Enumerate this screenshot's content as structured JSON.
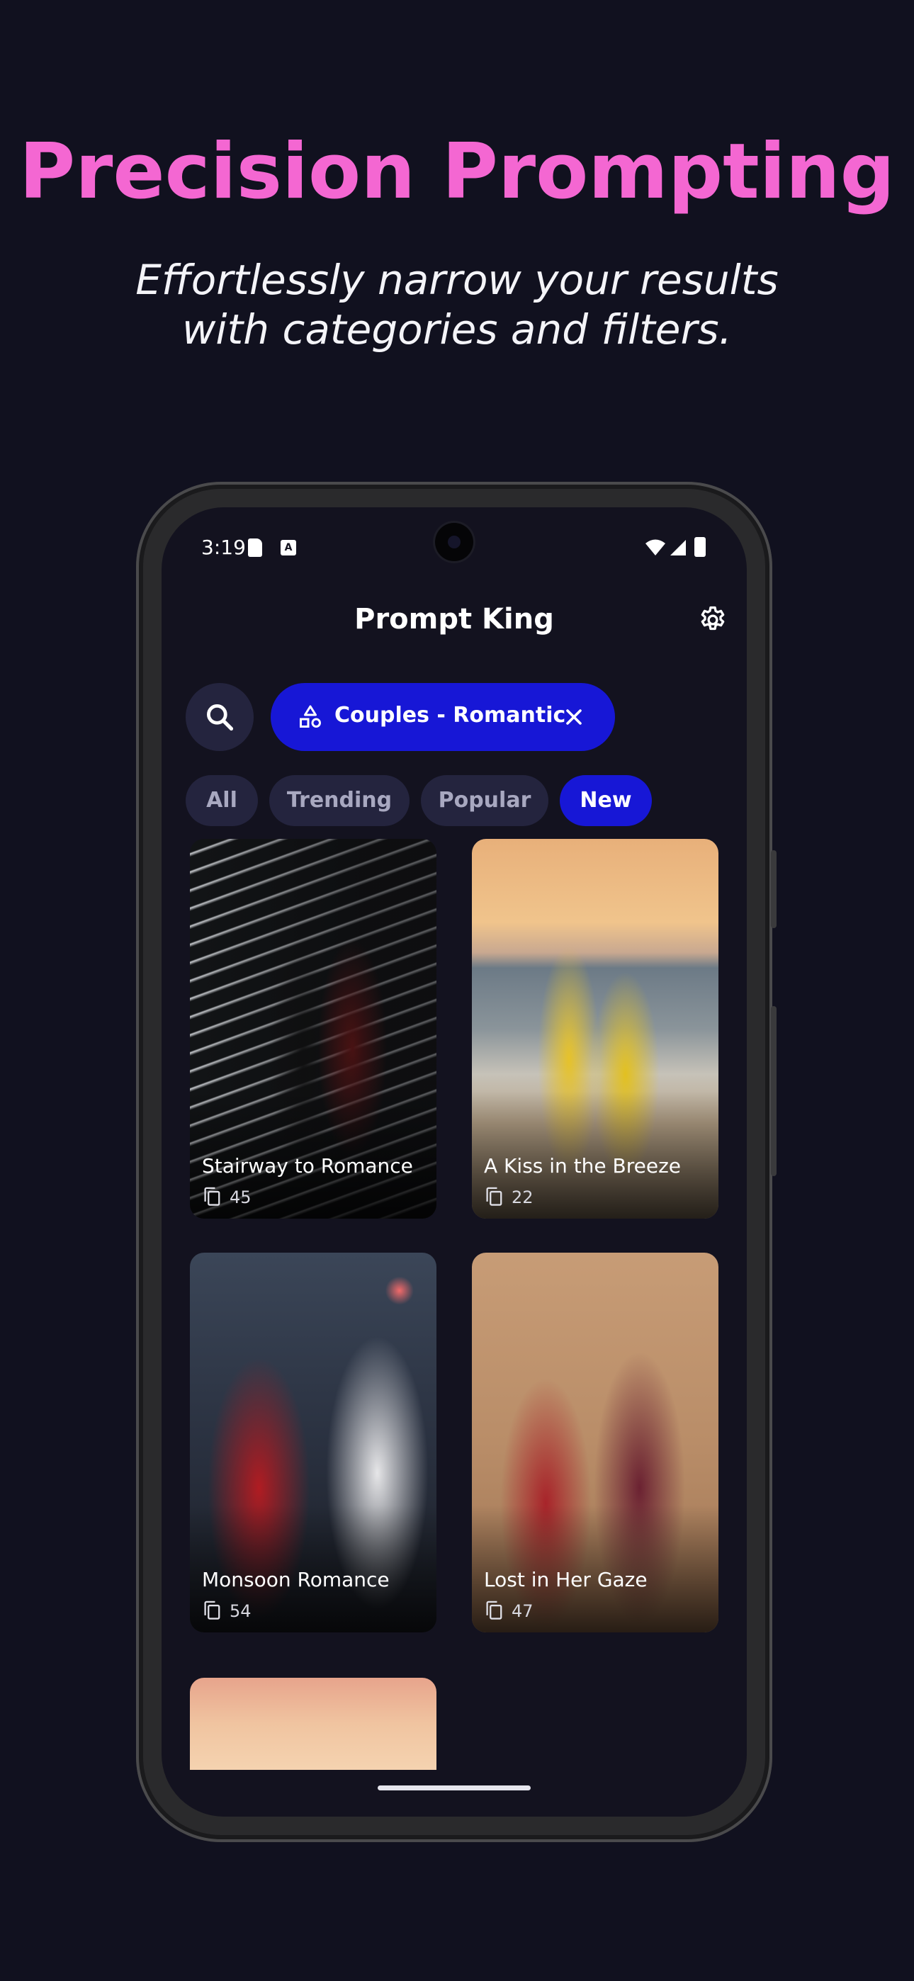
{
  "promo": {
    "headline": "Precision Prompting",
    "subline_1": "Effortlessly narrow your results",
    "subline_2": "with categories and filters."
  },
  "status_bar": {
    "time": "3:19"
  },
  "app": {
    "title": "Prompt King"
  },
  "category_chip": {
    "label": "Couples - Romantic"
  },
  "filters": [
    {
      "label": "All",
      "active": false
    },
    {
      "label": "Trending",
      "active": false
    },
    {
      "label": "Popular",
      "active": false
    },
    {
      "label": "New",
      "active": true
    }
  ],
  "cards": [
    {
      "title": "Stairway to Romance",
      "count": "45"
    },
    {
      "title": "A Kiss in the Breeze",
      "count": "22"
    },
    {
      "title": "Monsoon Romance",
      "count": "54"
    },
    {
      "title": "Lost in Her Gaze",
      "count": "47"
    }
  ],
  "colors": {
    "accent_pink": "#f467d2",
    "accent_blue": "#1717d6",
    "background": "#11111f"
  }
}
